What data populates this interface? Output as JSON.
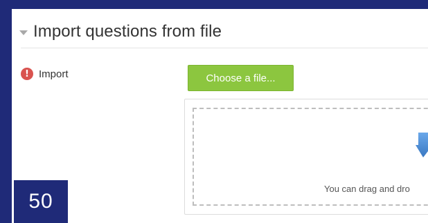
{
  "section": {
    "title": "Import questions from file",
    "collapse_icon": "triangle-down-icon"
  },
  "form": {
    "import_label": "Import",
    "required_icon": "exclamation-circle-icon",
    "required_color": "#d9534f",
    "choose_button_label": "Choose a file...",
    "choose_button_color": "#8cc63f"
  },
  "dropzone": {
    "hint_text": "You can drag and dro",
    "upload_icon": "upload-arrow-icon",
    "upload_icon_color": "#4a90d9"
  },
  "page_badge": {
    "number": "50",
    "color": "#1f2a78"
  }
}
